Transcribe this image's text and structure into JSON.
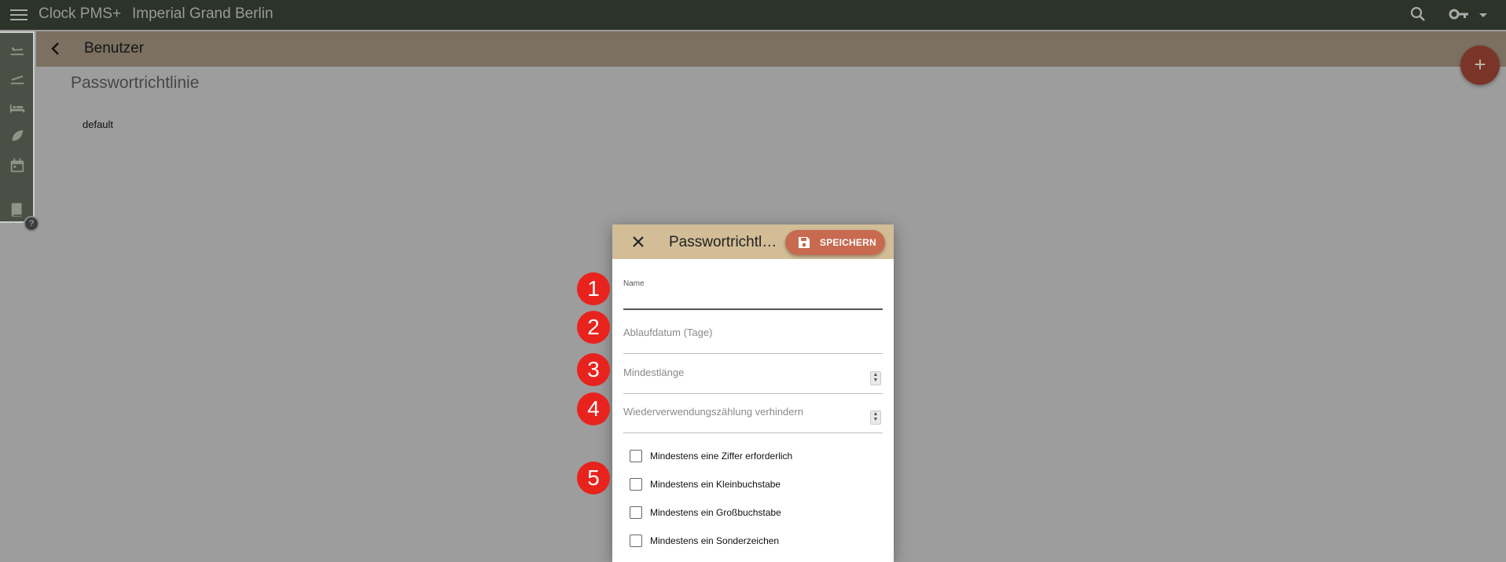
{
  "topbar": {
    "app_name": "Clock PMS+",
    "hotel_name": "Imperial Grand Berlin"
  },
  "subheader": {
    "title": "Benutzer",
    "fab_label": "+"
  },
  "page": {
    "title": "Passwortrichtlinie",
    "items": [
      "default"
    ]
  },
  "help_label": "?",
  "dialog": {
    "title": "Passwortrichtlinie",
    "save_label": "SPEICHERN",
    "fields": {
      "name_label": "Name",
      "expiry_placeholder": "Ablaufdatum (Tage)",
      "min_length_placeholder": "Mindestlänge",
      "reuse_placeholder": "Wiederverwendungszählung verhindern"
    },
    "checkboxes": [
      {
        "label": "Mindestens eine Ziffer erforderlich",
        "checked": false
      },
      {
        "label": "Mindestens ein Kleinbuchstabe",
        "checked": false
      },
      {
        "label": "Mindestens ein Großbuchstabe",
        "checked": false
      },
      {
        "label": "Mindestens ein Sonderzeichen",
        "checked": false
      }
    ]
  },
  "callouts": [
    "1",
    "2",
    "3",
    "4",
    "5"
  ],
  "colors": {
    "topbar": "#2c3328",
    "subheader": "#7b7061",
    "dialog_header": "#d2bd97",
    "save_button": "#c86a50",
    "callout": "#e8231e"
  }
}
